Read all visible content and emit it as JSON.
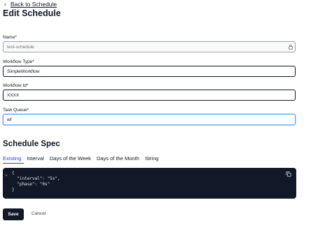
{
  "nav": {
    "back_label": "Back to Schedule"
  },
  "page": {
    "title": "Edit Schedule"
  },
  "form": {
    "name": {
      "label": "Name*",
      "value": "test-schedule"
    },
    "workflow_type": {
      "label": "Workflow Type*",
      "value": "SimpleWorkflow"
    },
    "workflow_id": {
      "label": "Workflow Id*",
      "value": "XXXX"
    },
    "task_queue": {
      "label": "Task Queue*",
      "value": "wf"
    }
  },
  "spec": {
    "title": "Schedule Spec",
    "tabs": [
      "Existing",
      "Interval",
      "Days of the Week",
      "Days of the Month",
      "String"
    ],
    "active_tab": "Existing",
    "code_lines": [
      "{",
      "  \"interval\": \"5s\",",
      "  \"phase\": \"0s\"",
      "}"
    ]
  },
  "actions": {
    "save_label": "Save",
    "cancel_label": "Cancel"
  },
  "colors": {
    "primary": "#111827",
    "accent": "#1d4ed8",
    "code_bg": "#111827",
    "focus": "#60a5fa"
  },
  "icons": {
    "back": "chevron-left-icon",
    "lock": "lock-icon",
    "copy": "copy-icon",
    "collapse": "chevron-down-icon"
  }
}
